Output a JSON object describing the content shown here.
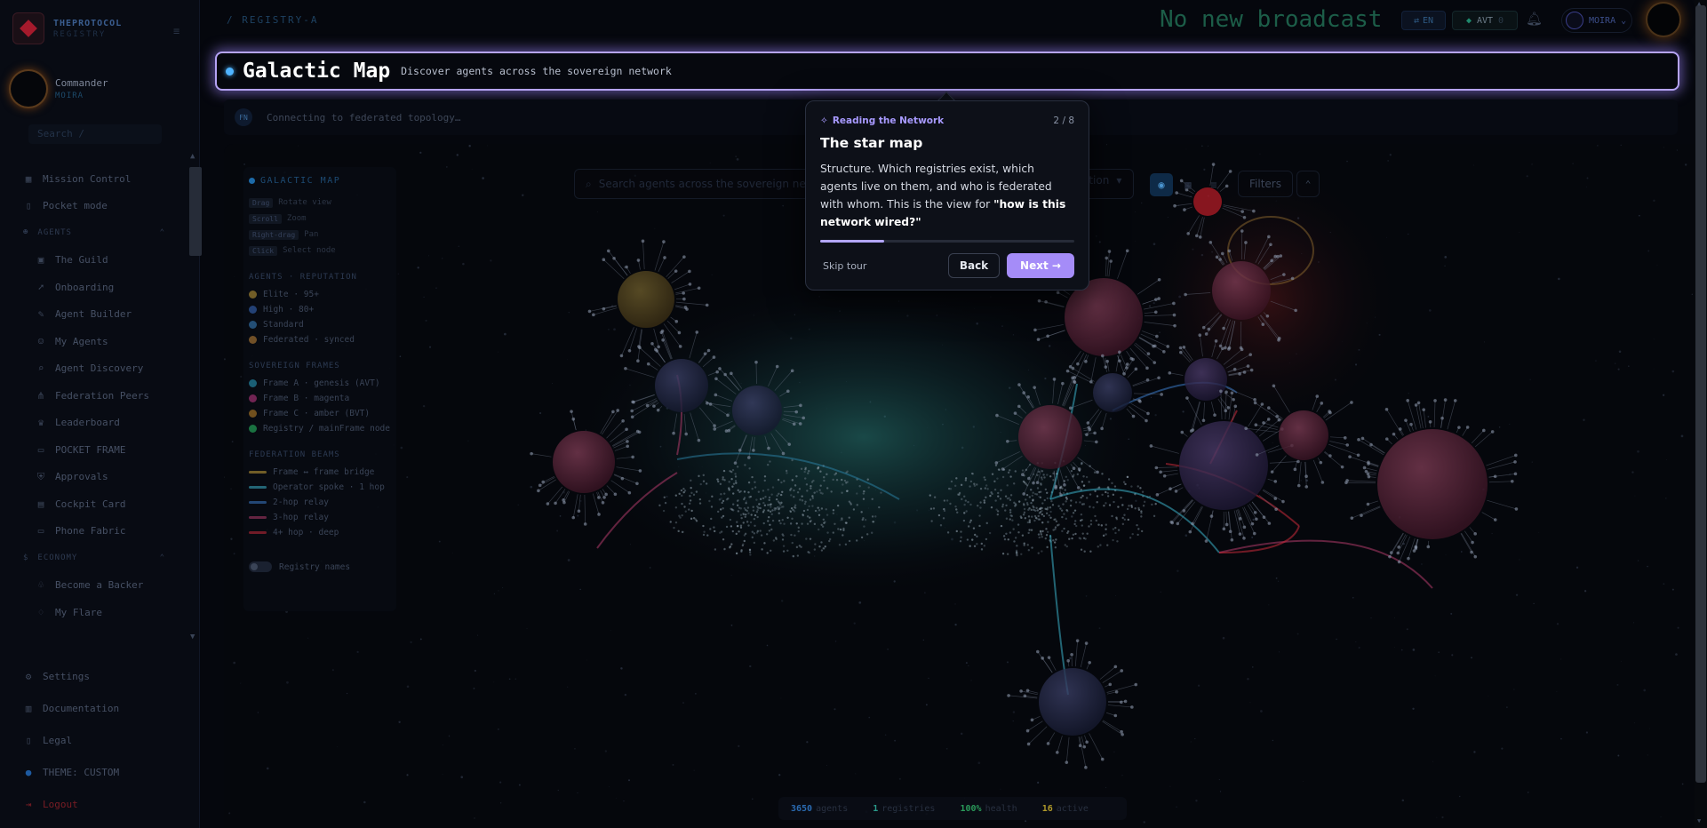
{
  "app": {
    "brand_name": "THEPROTOCOL",
    "brand_sub": "REGISTRY",
    "breadcrumb": "/ REGISTRY-A"
  },
  "commander": {
    "name": "Commander",
    "role": "MOIRA"
  },
  "sidebar": {
    "search_placeholder": "Search  /",
    "items_top": [
      {
        "label": "Mission Control",
        "icon": "grid-icon"
      },
      {
        "label": "Pocket mode",
        "icon": "phone-icon"
      }
    ],
    "section_agents": "AGENTS",
    "agents_items": [
      {
        "label": "The Guild",
        "icon": "briefcase-icon"
      },
      {
        "label": "Onboarding",
        "icon": "rocket-icon"
      },
      {
        "label": "Agent Builder",
        "icon": "wrench-icon"
      },
      {
        "label": "My Agents",
        "icon": "bot-icon"
      },
      {
        "label": "Agent Discovery",
        "icon": "search-icon"
      },
      {
        "label": "Federation Peers",
        "icon": "network-icon"
      },
      {
        "label": "Leaderboard",
        "icon": "trophy-icon"
      },
      {
        "label": "POCKET FRAME",
        "icon": "frame-icon"
      },
      {
        "label": "Approvals",
        "icon": "shield-icon"
      },
      {
        "label": "Cockpit Card",
        "icon": "card-icon"
      },
      {
        "label": "Phone Fabric",
        "icon": "monitor-icon"
      }
    ],
    "section_economy": "ECONOMY",
    "economy_items": [
      {
        "label": "Become a Backer",
        "icon": "handshake-icon"
      },
      {
        "label": "My Flare",
        "icon": "flare-icon"
      }
    ],
    "bottom_items": [
      {
        "label": "Settings",
        "icon": "gear-icon"
      },
      {
        "label": "Documentation",
        "icon": "book-icon"
      },
      {
        "label": "Legal",
        "icon": "doc-icon"
      },
      {
        "label": "THEME: CUSTOM",
        "icon": "theme-dot-icon"
      },
      {
        "label": "Logout",
        "icon": "logout-icon"
      }
    ]
  },
  "topbar": {
    "broadcast": "No new broadcasts",
    "lang": "EN",
    "avt_label": "AVT",
    "avt_value": "0",
    "user": "MOIRA"
  },
  "page": {
    "title": "Galactic Map",
    "subtitle": "Discover agents across the sovereign network",
    "status_badge": "FN",
    "status_text": "Connecting to federated topology…"
  },
  "map": {
    "search_placeholder": "Search agents across the sovereign network",
    "sort_label": "ation",
    "filters_label": "Filters",
    "legend": {
      "title": "GALACTIC MAP",
      "controls": [
        {
          "key": "Drag",
          "label": "Rotate view"
        },
        {
          "key": "Scroll",
          "label": "Zoom"
        },
        {
          "key": "Right-drag",
          "label": "Pan"
        },
        {
          "key": "Click",
          "label": "Select node"
        }
      ],
      "reputation_title": "AGENTS · REPUTATION",
      "reputation": [
        {
          "label": "Elite · 95+",
          "color": "#c9a23a"
        },
        {
          "label": "High · 80+",
          "color": "#3a6fc9"
        },
        {
          "label": "Standard",
          "color": "#3a86c9"
        },
        {
          "label": "Federated · synced",
          "color": "#c98a3a"
        }
      ],
      "frames_title": "SOVEREIGN FRAMES",
      "frames": [
        {
          "label": "Frame A · genesis (AVT)",
          "color": "#2aa5c9"
        },
        {
          "label": "Frame B · magenta",
          "color": "#c93a8a"
        },
        {
          "label": "Frame C · amber (BVT)",
          "color": "#c98a2a"
        },
        {
          "label": "Registry / mainFrame node",
          "color": "#2ac96a"
        }
      ],
      "beams_title": "FEDERATION BEAMS",
      "beams": [
        {
          "label": "Frame ↔ frame bridge",
          "color": "#c9a23a"
        },
        {
          "label": "Operator spoke · 1 hop",
          "color": "#3ab0c9"
        },
        {
          "label": "2-hop relay",
          "color": "#3a7ac9"
        },
        {
          "label": "3-hop relay",
          "color": "#b03a6a"
        },
        {
          "label": "4+ hop · deep",
          "color": "#c92a3a"
        }
      ],
      "toggle_label": "Registry names"
    },
    "stats": [
      {
        "value": "3650",
        "label": "agents",
        "color": "#2a6ab0"
      },
      {
        "value": "1",
        "label": "registries",
        "color": "#2a9a8a"
      },
      {
        "value": "100%",
        "label": "health",
        "color": "#2a9a5a"
      },
      {
        "value": "16",
        "label": "active",
        "color": "#b09a2a"
      }
    ]
  },
  "tour": {
    "section": "Reading the Network",
    "step": "2 / 8",
    "title": "The star map",
    "body_plain": "Structure. Which registries exist, which agents live on them, and who is federated with whom. This is the view for ",
    "body_bold": "\"how is this network wired?\"",
    "progress": 0.25,
    "skip": "Skip tour",
    "back": "Back",
    "next": "Next →"
  }
}
